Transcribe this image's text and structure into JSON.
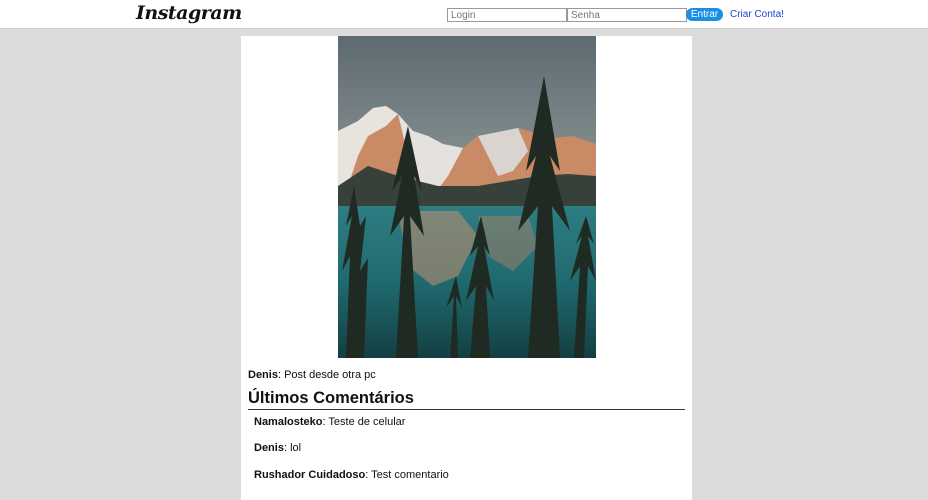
{
  "header": {
    "logo": "Instagram",
    "login_placeholder": "Login",
    "password_placeholder": "Senha",
    "enter_label": "Entrar",
    "signup_label": "Criar Conta!"
  },
  "post": {
    "image_alt": "mountain-lake-photo",
    "author": "Denis",
    "caption": ": Post desde otra pc"
  },
  "comments_section": {
    "title": "Últimos Comentários",
    "comments": [
      {
        "author": "Namalosteko",
        "text": ": Teste de celular"
      },
      {
        "author": "Denis",
        "text": ": lol"
      },
      {
        "author": "Rushador Cuidadoso",
        "text": ": Test comentario"
      }
    ]
  },
  "colors": {
    "accent": "#1b8fe6",
    "link": "#1d3fd6",
    "page_background": "#dcdcdc"
  }
}
